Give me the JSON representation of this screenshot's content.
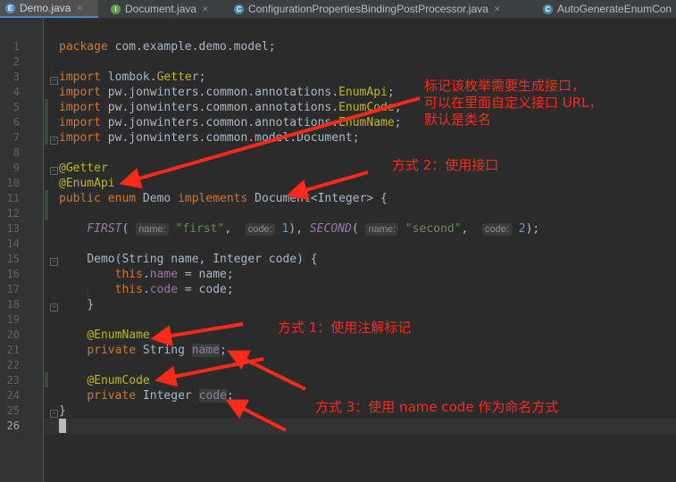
{
  "tabs": [
    {
      "label": "Demo.java",
      "icon": "E",
      "icon_name": "enum-icon",
      "active": true
    },
    {
      "label": "Document.java",
      "icon": "I",
      "icon_name": "interface-icon",
      "active": false
    },
    {
      "label": "ConfigurationPropertiesBindingPostProcessor.java",
      "icon": "C",
      "icon_name": "class-icon",
      "active": false
    },
    {
      "label": "AutoGenerateEnumCon",
      "icon": "C",
      "icon_name": "class-icon",
      "active": false
    }
  ],
  "line_numbers": [
    "1",
    "2",
    "3",
    "4",
    "5",
    "6",
    "7",
    "8",
    "9",
    "10",
    "11",
    "12",
    "13",
    "14",
    "15",
    "16",
    "17",
    "18",
    "19",
    "20",
    "21",
    "22",
    "23",
    "24",
    "25",
    "26"
  ],
  "code": {
    "l1": {
      "kw": "package",
      "rest": " com.example.demo.model;"
    },
    "l3": {
      "kw": "import",
      "rest": " lombok.",
      "ann": "Getter",
      ";": ";"
    },
    "l4": {
      "kw": "import",
      "rest": " pw.jonwinters.common.annotations.",
      "ann": "EnumApi",
      "end": ";"
    },
    "l5": {
      "kw": "import",
      "rest": " pw.jonwinters.common.annotations.",
      "ann": "EnumCode",
      "end": ";"
    },
    "l6": {
      "kw": "import",
      "rest": " pw.jonwinters.common.annotations.",
      "ann": "EnumName",
      "end": ";"
    },
    "l7": {
      "kw": "import",
      "rest": " pw.jonwinters.common.model.Document;"
    },
    "l9": "@Getter",
    "l10": "@EnumApi",
    "l11": {
      "kw1": "public enum",
      "name": " Demo ",
      "kw2": "implements",
      "rest": " Document<Integer> {"
    },
    "l13": {
      "c1": "FIRST",
      "p1": "(",
      "h1": "name:",
      "s1": "\"first\"",
      "sep1": ", ",
      "h2": "code:",
      "n1": "1",
      "e1": "), ",
      "c2": "SECOND",
      "p2": "(",
      "h3": "name:",
      "s2": "\"second\"",
      "sep2": ", ",
      "h4": "code:",
      "n2": "2",
      "e2": ");"
    },
    "l15": "Demo(String name, Integer code) {",
    "l16": {
      "kw": "this",
      "dot": ".",
      "fld": "name",
      "rest": " = name;"
    },
    "l17": {
      "kw": "this",
      "dot": ".",
      "fld": "code",
      "rest": " = code;"
    },
    "l18": "}",
    "l20": "@EnumName",
    "l21": {
      "kw": "private",
      "type": " String ",
      "fld": "name",
      "end": ";"
    },
    "l23": "@EnumCode",
    "l24": {
      "kw": "private",
      "type": " Integer ",
      "fld": "code",
      "end": ";"
    },
    "l25": "}"
  },
  "notes": {
    "n1": "标记该枚举需要生成接口，\n可以在里面自定义接口 URL，\n默认是类名",
    "n2": "方式 2：使用接口",
    "n3": "方式 1：使用注解标记",
    "n4": "方式 3：使用 name code 作为命名方式"
  },
  "colors": {
    "annotation_text": "#ff2a1a",
    "background": "#2b2b2b",
    "keyword": "#cc7832"
  }
}
